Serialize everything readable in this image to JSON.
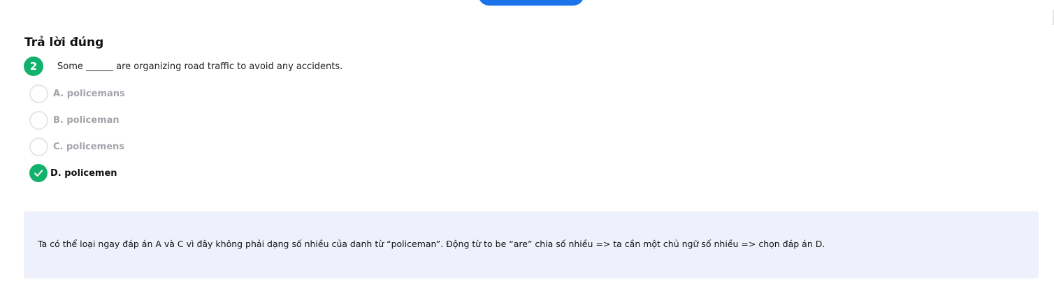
{
  "section": {
    "title": "Trả lời đúng"
  },
  "question": {
    "number": "2",
    "text": "Some ______ are organizing road traffic to avoid any accidents."
  },
  "options": [
    {
      "label": "A. policemans",
      "selected": false
    },
    {
      "label": "B. policeman",
      "selected": false
    },
    {
      "label": "C. policemens",
      "selected": false
    },
    {
      "label": "D. policemen",
      "selected": true
    }
  ],
  "explanation": {
    "text": "Ta có thể loại ngay đáp án A và C vì đây không phải dạng số nhiều của danh từ “policeman”. Động từ to be “are” chia số nhiều => ta cần một chủ ngữ số nhiều => chọn đáp án D."
  },
  "colors": {
    "accent_blue": "#1a73e8",
    "correct_green": "#12b16c",
    "explanation_bg": "#eef1fc",
    "option_muted": "#a3a3ab"
  },
  "icons": {
    "correct_option": "check-circle-icon"
  }
}
